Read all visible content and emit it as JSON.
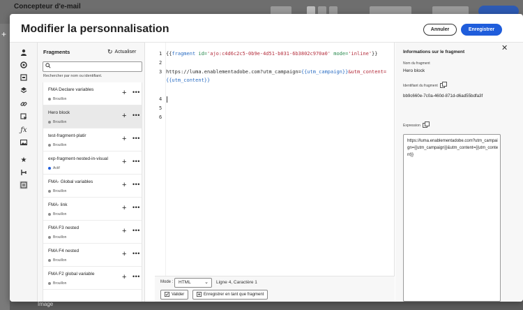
{
  "background": {
    "app_title": "Concepteur d'e-mail",
    "bottom_label": "Image",
    "accent": "#1f5ddb"
  },
  "modal": {
    "title": "Modifier la personnalisation",
    "cancel_label": "Annuler",
    "save_label": "Enregistrer"
  },
  "rail": {
    "icons": [
      "person-icon",
      "audience-icon",
      "form-icon",
      "layers-icon",
      "link-icon",
      "cursor-icon",
      "function-icon",
      "image-icon",
      "star-icon",
      "connector-icon",
      "fragment-icon"
    ],
    "expand_glyph": "»"
  },
  "fragments": {
    "heading": "Fragments",
    "refresh_label": "Actualiser",
    "search_placeholder": "",
    "search_hint": "Rechercher par nom ou identifiant.",
    "add_glyph": "+",
    "more_glyph": "•••",
    "items": [
      {
        "name": "FMA Declare variables",
        "status": "Brouillon",
        "active": false
      },
      {
        "name": "Hero block",
        "status": "Brouillon",
        "active": false,
        "selected": true
      },
      {
        "name": "test-fragment-platir",
        "status": "Brouillon",
        "active": false
      },
      {
        "name": "exp-fragment-nested-in-visual",
        "status": "Actif",
        "active": true
      },
      {
        "name": "FMA- Global variables",
        "status": "Brouillon",
        "active": false
      },
      {
        "name": "FMA- link",
        "status": "Brouillon",
        "active": false
      },
      {
        "name": "FMA F3 nested",
        "status": "Brouillon",
        "active": false
      },
      {
        "name": "FMA F4 nested",
        "status": "Brouillon",
        "active": false
      },
      {
        "name": "FMA F2 global variable",
        "status": "Brouillon",
        "active": false
      }
    ]
  },
  "editor": {
    "line_numbers": [
      "1",
      "2",
      "3",
      "",
      "4",
      "5",
      "6"
    ],
    "line1": {
      "open": "{{",
      "kw": "fragment",
      "attr1": " id=",
      "val1": "'ajo:c4d6c2c5-0b9e-4d51-b031-6b3802c970a0'",
      "attr2": " mode=",
      "val2": "'inline'",
      "close": "}}"
    },
    "line3": {
      "url": "https://luma.enablementadobe.com?utm_campaign=",
      "var1": "{{utm_campaign}}",
      "amp": "&utm_content=",
      "var2": "{{utm_content}}"
    },
    "mode_label": "Mode :",
    "mode_value": "HTML",
    "position": "Ligne 4, Caractère 1",
    "validate_label": "Valider",
    "save_fragment_label": "Enregistrer en tant que fragment"
  },
  "info": {
    "title": "Informations sur le fragment",
    "name_label": "Nom du fragment",
    "name_value": "Hero block",
    "id_label": "Identifiant du fragment",
    "id_value": "bb9c660e-7c0a-460d-871d-d6ad55bdfa3f",
    "expression_label": "Expression",
    "expression_value": "https://luma.enablementadobe.com?utm_campaign={{utm_campaign}}&utm_content={{utm_content}}"
  }
}
